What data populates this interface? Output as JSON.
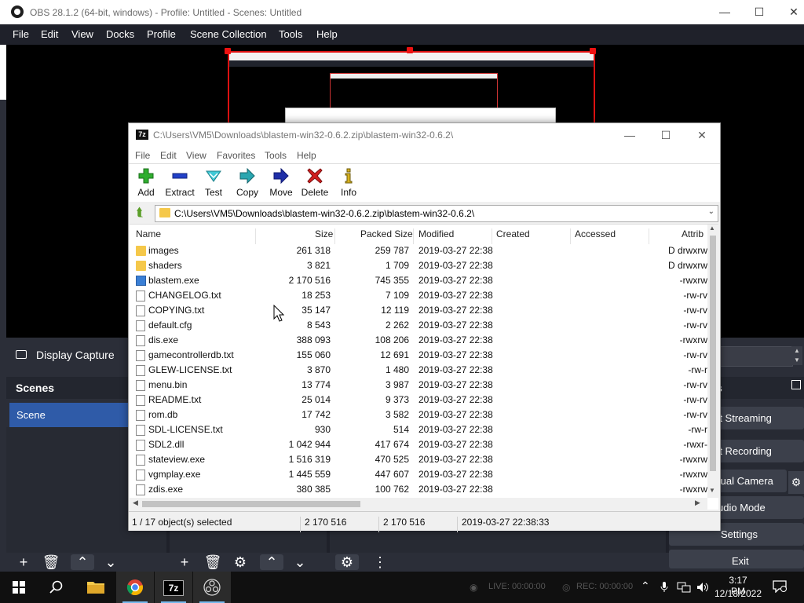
{
  "obs": {
    "title": "OBS 28.1.2 (64-bit, windows) - Profile: Untitled - Scenes: Untitled",
    "menu": [
      "File",
      "Edit",
      "View",
      "Docks",
      "Profile",
      "Scene Collection",
      "Tools",
      "Help"
    ],
    "source_label": "Display Capture",
    "scenes_header": "Scenes",
    "scene_item": "Scene",
    "controls": [
      "rt Streaming",
      "rt Recording",
      "tual Camera",
      "udio Mode",
      "Settings",
      "Exit"
    ],
    "window_buttons": {
      "minimize": "—",
      "maximize": "☐",
      "close": "✕"
    }
  },
  "sevenzip": {
    "title": "C:\\Users\\VM5\\Downloads\\blastem-win32-0.6.2.zip\\blastem-win32-0.6.2\\",
    "menu": [
      "File",
      "Edit",
      "View",
      "Favorites",
      "Tools",
      "Help"
    ],
    "toolbar": [
      "Add",
      "Extract",
      "Test",
      "Copy",
      "Move",
      "Delete",
      "Info"
    ],
    "address": "C:\\Users\\VM5\\Downloads\\blastem-win32-0.6.2.zip\\blastem-win32-0.6.2\\",
    "columns": [
      "Name",
      "Size",
      "Packed Size",
      "Modified",
      "Created",
      "Accessed",
      "Attrib"
    ],
    "files": [
      {
        "name": "images",
        "size": "261 318",
        "packed": "259 787",
        "modified": "2019-03-27 22:38",
        "attrib": "D drwxrw",
        "type": "folder"
      },
      {
        "name": "shaders",
        "size": "3 821",
        "packed": "1 709",
        "modified": "2019-03-27 22:38",
        "attrib": "D drwxrw",
        "type": "folder"
      },
      {
        "name": "blastem.exe",
        "size": "2 170 516",
        "packed": "745 355",
        "modified": "2019-03-27 22:38",
        "attrib": "-rwxrw",
        "type": "exe"
      },
      {
        "name": "CHANGELOG.txt",
        "size": "18 253",
        "packed": "7 109",
        "modified": "2019-03-27 22:38",
        "attrib": "-rw-rv",
        "type": "file"
      },
      {
        "name": "COPYING.txt",
        "size": "35 147",
        "packed": "12 119",
        "modified": "2019-03-27 22:38",
        "attrib": "-rw-rv",
        "type": "file"
      },
      {
        "name": "default.cfg",
        "size": "8 543",
        "packed": "2 262",
        "modified": "2019-03-27 22:38",
        "attrib": "-rw-rv",
        "type": "file"
      },
      {
        "name": "dis.exe",
        "size": "388 093",
        "packed": "108 206",
        "modified": "2019-03-27 22:38",
        "attrib": "-rwxrw",
        "type": "file"
      },
      {
        "name": "gamecontrollerdb.txt",
        "size": "155 060",
        "packed": "12 691",
        "modified": "2019-03-27 22:38",
        "attrib": "-rw-rv",
        "type": "file"
      },
      {
        "name": "GLEW-LICENSE.txt",
        "size": "3 870",
        "packed": "1 480",
        "modified": "2019-03-27 22:38",
        "attrib": "-rw-r",
        "type": "file"
      },
      {
        "name": "menu.bin",
        "size": "13 774",
        "packed": "3 987",
        "modified": "2019-03-27 22:38",
        "attrib": "-rw-rv",
        "type": "file"
      },
      {
        "name": "README.txt",
        "size": "25 014",
        "packed": "9 373",
        "modified": "2019-03-27 22:38",
        "attrib": "-rw-rv",
        "type": "file"
      },
      {
        "name": "rom.db",
        "size": "17 742",
        "packed": "3 582",
        "modified": "2019-03-27 22:38",
        "attrib": "-rw-rv",
        "type": "file"
      },
      {
        "name": "SDL-LICENSE.txt",
        "size": "930",
        "packed": "514",
        "modified": "2019-03-27 22:38",
        "attrib": "-rw-r",
        "type": "file"
      },
      {
        "name": "SDL2.dll",
        "size": "1 042 944",
        "packed": "417 674",
        "modified": "2019-03-27 22:38",
        "attrib": "-rwxr-",
        "type": "file"
      },
      {
        "name": "stateview.exe",
        "size": "1 516 319",
        "packed": "470 525",
        "modified": "2019-03-27 22:38",
        "attrib": "-rwxrw",
        "type": "file"
      },
      {
        "name": "vgmplay.exe",
        "size": "1 445 559",
        "packed": "447 607",
        "modified": "2019-03-27 22:38",
        "attrib": "-rwxrw",
        "type": "file"
      },
      {
        "name": "zdis.exe",
        "size": "380 385",
        "packed": "100 762",
        "modified": "2019-03-27 22:38",
        "attrib": "-rwxrw",
        "type": "file"
      }
    ],
    "status": {
      "selected": "1 / 17 object(s) selected",
      "size": "2 170 516",
      "packed": "2 170 516",
      "modified": "2019-03-27 22:38:33"
    }
  },
  "taskbar": {
    "live": "LIVE: 00:00:00",
    "rec": "REC: 00:00:00",
    "time": "3:17 PM",
    "date": "12/18/2022",
    "logo_7z": "7z"
  }
}
